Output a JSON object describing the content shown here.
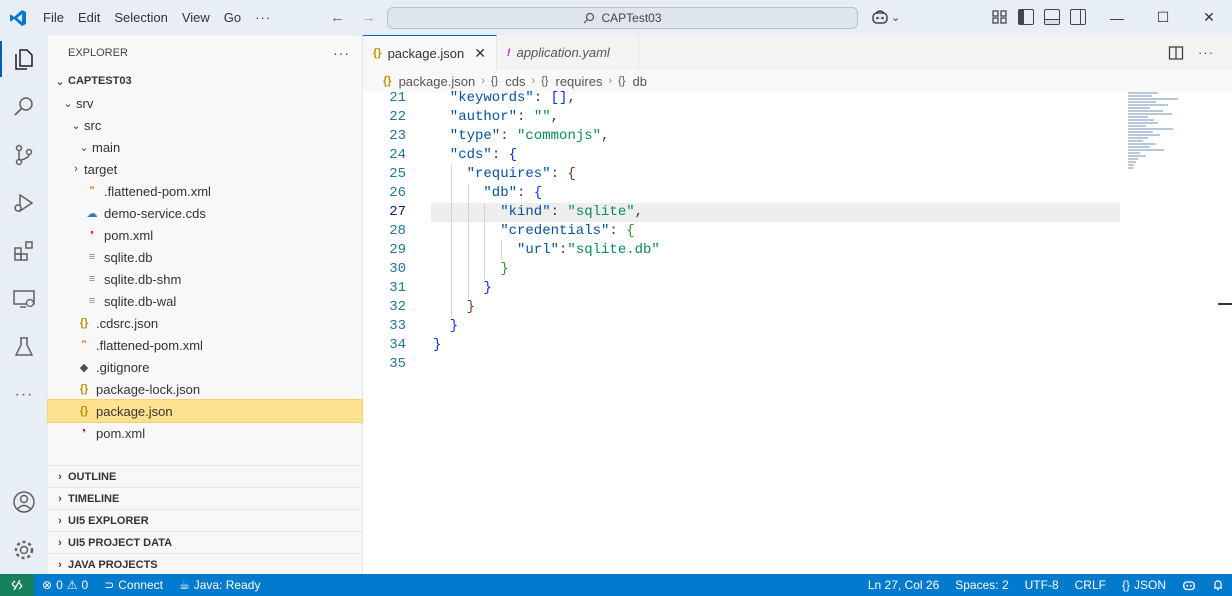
{
  "titlebar": {
    "menu": [
      "File",
      "Edit",
      "Selection",
      "View",
      "Go",
      "···"
    ],
    "search_text": "CAPTest03",
    "window_controls": [
      "minimize",
      "maximize",
      "close"
    ]
  },
  "activity_bar": {
    "items": [
      "explorer",
      "search",
      "source-control",
      "run-and-debug",
      "extensions",
      "remote-explorer",
      "testing",
      "more"
    ],
    "bottom": [
      "accounts",
      "manage"
    ]
  },
  "explorer": {
    "header": "EXPLORER",
    "more": "···",
    "root": "CAPTEST03",
    "rows": [
      {
        "label": "srv",
        "indent": 1,
        "chevron": "down",
        "icon": ""
      },
      {
        "label": "src",
        "indent": 2,
        "chevron": "down",
        "icon": ""
      },
      {
        "label": "main",
        "indent": 3,
        "chevron": "down",
        "icon": ""
      },
      {
        "label": "target",
        "indent": 2,
        "chevron": "right",
        "icon": ""
      },
      {
        "label": ".flattened-pom.xml",
        "indent": 2,
        "chevron": "",
        "icon": "rss"
      },
      {
        "label": "demo-service.cds",
        "indent": 2,
        "chevron": "",
        "icon": "cds"
      },
      {
        "label": "pom.xml",
        "indent": 2,
        "chevron": "",
        "icon": "maven"
      },
      {
        "label": "sqlite.db",
        "indent": 2,
        "chevron": "",
        "icon": "lines"
      },
      {
        "label": "sqlite.db-shm",
        "indent": 2,
        "chevron": "",
        "icon": "lines"
      },
      {
        "label": "sqlite.db-wal",
        "indent": 2,
        "chevron": "",
        "icon": "lines"
      },
      {
        "label": ".cdsrc.json",
        "indent": 1,
        "chevron": "",
        "icon": "json"
      },
      {
        "label": ".flattened-pom.xml",
        "indent": 1,
        "chevron": "",
        "icon": "rss"
      },
      {
        "label": ".gitignore",
        "indent": 1,
        "chevron": "",
        "icon": "git"
      },
      {
        "label": "package-lock.json",
        "indent": 1,
        "chevron": "",
        "icon": "json"
      },
      {
        "label": "package.json",
        "indent": 1,
        "chevron": "",
        "icon": "json",
        "selected": true
      },
      {
        "label": "pom.xml",
        "indent": 1,
        "chevron": "",
        "icon": "maven"
      }
    ],
    "panels": [
      "OUTLINE",
      "TIMELINE",
      "UI5 EXPLORER",
      "UI5 PROJECT DATA",
      "JAVA PROJECTS"
    ]
  },
  "tabs": [
    {
      "label": "package.json",
      "active": true,
      "icon": "{}"
    },
    {
      "label": "application.yaml",
      "active": false,
      "icon": "!"
    }
  ],
  "breadcrumb": [
    {
      "icon": "{}",
      "label": "package.json"
    },
    {
      "icon": "{}",
      "label": "cds"
    },
    {
      "icon": "{}",
      "label": "requires"
    },
    {
      "icon": "{}",
      "label": "db"
    }
  ],
  "editor": {
    "cursor_line": 27,
    "lines": [
      {
        "n": "21",
        "indent": 1,
        "tokens": [
          [
            "key",
            "\"keywords\""
          ],
          [
            "pun",
            ": "
          ],
          [
            "b1",
            "[]"
          ],
          [
            "pun",
            ","
          ]
        ]
      },
      {
        "n": "22",
        "indent": 1,
        "tokens": [
          [
            "key",
            "\"author\""
          ],
          [
            "pun",
            ": "
          ],
          [
            "str",
            "\"\""
          ],
          [
            "pun",
            ","
          ]
        ]
      },
      {
        "n": "23",
        "indent": 1,
        "tokens": [
          [
            "key",
            "\"type\""
          ],
          [
            "pun",
            ": "
          ],
          [
            "str",
            "\"commonjs\""
          ],
          [
            "pun",
            ","
          ]
        ]
      },
      {
        "n": "24",
        "indent": 1,
        "tokens": [
          [
            "key",
            "\"cds\""
          ],
          [
            "pun",
            ": "
          ],
          [
            "b1",
            "{"
          ]
        ]
      },
      {
        "n": "25",
        "indent": 2,
        "tokens": [
          [
            "key",
            "\"requires\""
          ],
          [
            "pun",
            ": "
          ],
          [
            "b3",
            "{"
          ]
        ]
      },
      {
        "n": "26",
        "indent": 3,
        "tokens": [
          [
            "key",
            "\"db\""
          ],
          [
            "pun",
            ": "
          ],
          [
            "b1",
            "{"
          ]
        ]
      },
      {
        "n": "27",
        "indent": 4,
        "tokens": [
          [
            "key",
            "\"kind\""
          ],
          [
            "pun",
            ": "
          ],
          [
            "str",
            "\"sqlite\""
          ],
          [
            "pun",
            ","
          ]
        ]
      },
      {
        "n": "28",
        "indent": 4,
        "tokens": [
          [
            "key",
            "\"credentials\""
          ],
          [
            "pun",
            ": "
          ],
          [
            "b2",
            "{"
          ]
        ]
      },
      {
        "n": "29",
        "indent": 5,
        "tokens": [
          [
            "key",
            "\"url\""
          ],
          [
            "pun",
            ":"
          ],
          [
            "str",
            "\"sqlite.db\""
          ]
        ]
      },
      {
        "n": "30",
        "indent": 4,
        "tokens": [
          [
            "b2",
            "}"
          ]
        ]
      },
      {
        "n": "31",
        "indent": 3,
        "tokens": [
          [
            "b1",
            "}"
          ]
        ]
      },
      {
        "n": "32",
        "indent": 2,
        "tokens": [
          [
            "b3",
            "}"
          ]
        ]
      },
      {
        "n": "33",
        "indent": 1,
        "tokens": [
          [
            "b1",
            "}"
          ]
        ]
      },
      {
        "n": "34",
        "indent": 0,
        "tokens": [
          [
            "b1",
            "}"
          ]
        ]
      },
      {
        "n": "35",
        "indent": 0,
        "tokens": []
      }
    ]
  },
  "statusbar": {
    "errors": "0",
    "warnings": "0",
    "connect": "Connect",
    "java": "Java: Ready",
    "position": "Ln 27, Col 26",
    "spaces": "Spaces: 2",
    "encoding": "UTF-8",
    "eol": "CRLF",
    "language": "JSON"
  }
}
